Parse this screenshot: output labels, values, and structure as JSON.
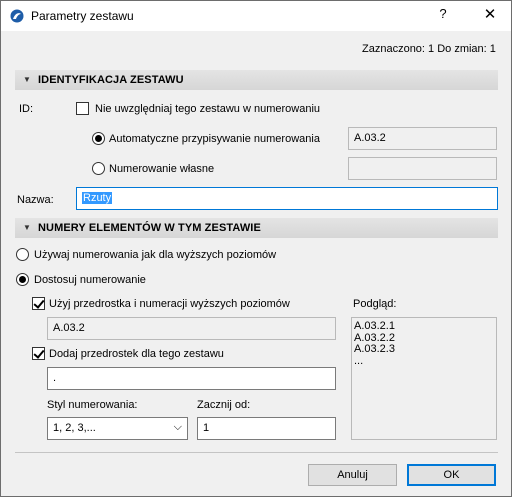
{
  "window": {
    "title": "Parametry zestawu",
    "help": "?",
    "close": "✕"
  },
  "status": "Zaznaczono: 1 Do zmian: 1",
  "ident": {
    "header": "IDENTYFIKACJA ZESTAWU",
    "id_label": "ID:",
    "exclude_label": "Nie uwzględniaj tego zestawu w numerowaniu",
    "auto_label": "Automatyczne przypisywanie numerowania",
    "auto_value": "A.03.2",
    "custom_label": "Numerowanie własne",
    "custom_value": "",
    "name_label": "Nazwa:",
    "name_value": "Rzuty"
  },
  "numbers": {
    "header": "NUMERY ELEMENTÓW W TYM ZESTAWIE",
    "use_parent_label": "Używaj numerowania jak dla wyższych poziomów",
    "custom_label": "Dostosuj numerowanie",
    "use_prefix_label": "Użyj przedrostka i numeracji wyższych poziomów",
    "prefix_value": "A.03.2",
    "add_prefix_label": "Dodaj przedrostek dla tego zestawu",
    "add_prefix_value": ".",
    "style_label": "Styl numerowania:",
    "style_value": "1, 2, 3,...",
    "start_label": "Zacznij od:",
    "start_value": "1",
    "preview_label": "Podgląd:",
    "preview_lines": [
      "A.03.2.1",
      "A.03.2.2",
      "A.03.2.3",
      "..."
    ]
  },
  "buttons": {
    "cancel": "Anuluj",
    "ok": "OK"
  },
  "colors": {
    "accent": "#0078d7",
    "selection": "#3399ff",
    "section_bg": "#dcdcdc"
  }
}
